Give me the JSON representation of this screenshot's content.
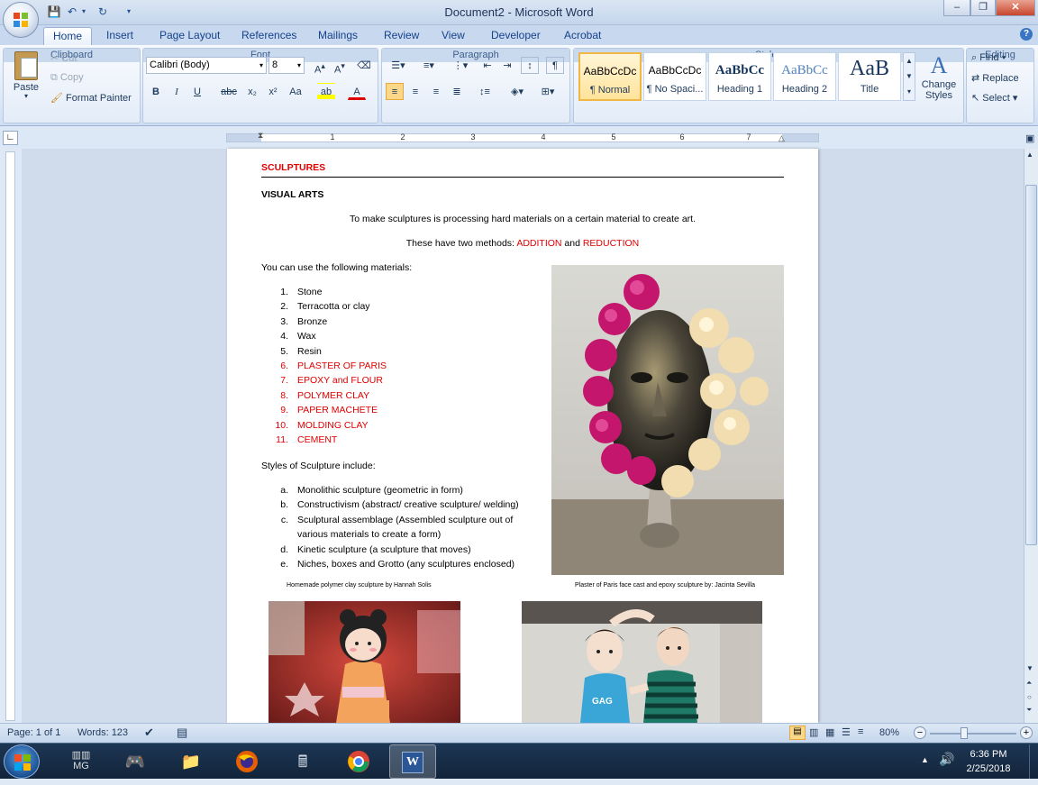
{
  "window": {
    "title": "Document2 - Microsoft Word",
    "minimize": "–",
    "restore": "❐",
    "close": "✕"
  },
  "tabs": [
    {
      "label": "Home"
    },
    {
      "label": "Insert"
    },
    {
      "label": "Page Layout"
    },
    {
      "label": "References"
    },
    {
      "label": "Mailings"
    },
    {
      "label": "Review"
    },
    {
      "label": "View"
    },
    {
      "label": "Developer"
    },
    {
      "label": "Acrobat"
    }
  ],
  "ribbon": {
    "clipboard": {
      "label": "Clipboard",
      "paste": "Paste",
      "cut": "Cut",
      "copy": "Copy",
      "format_painter": "Format Painter"
    },
    "font": {
      "label": "Font",
      "family": "Calibri (Body)",
      "size": "8"
    },
    "paragraph": {
      "label": "Paragraph"
    },
    "styles": {
      "label": "Styles",
      "items": [
        {
          "sample": "AaBbCcDc",
          "name": "¶ Normal"
        },
        {
          "sample": "AaBbCcDc",
          "name": "¶ No Spaci..."
        },
        {
          "sample": "AaBbCc",
          "name": "Heading 1"
        },
        {
          "sample": "AaBbCc",
          "name": "Heading 2"
        },
        {
          "sample": "AaB",
          "name": "Title"
        }
      ],
      "change_styles": "Change Styles"
    },
    "editing": {
      "label": "Editing",
      "find": "Find",
      "replace": "Replace",
      "select": "Select"
    }
  },
  "ruler": {
    "numbers": [
      "1",
      "2",
      "3",
      "4",
      "5",
      "6",
      "7"
    ]
  },
  "document": {
    "heading": "SCULPTURES",
    "subheading": "VISUAL ARTS",
    "intro": "To make sculptures is processing hard materials on a certain material to create art.",
    "methods_prefix": "These have two methods: ",
    "method_1": "ADDITION",
    "methods_and": " and ",
    "method_2": "REDUCTION",
    "materials_intro": "You can use the following materials:",
    "materials": [
      {
        "num": "1.",
        "text": "Stone",
        "red": false
      },
      {
        "num": "2.",
        "text": "Terracotta or clay",
        "red": false
      },
      {
        "num": "3.",
        "text": "Bronze",
        "red": false
      },
      {
        "num": "4.",
        "text": "Wax",
        "red": false
      },
      {
        "num": "5.",
        "text": "Resin",
        "red": false
      },
      {
        "num": "6.",
        "text": "PLASTER OF PARIS",
        "red": true
      },
      {
        "num": "7.",
        "text": "EPOXY and FLOUR",
        "red": true
      },
      {
        "num": "8.",
        "text": "POLYMER CLAY",
        "red": true
      },
      {
        "num": "9.",
        "text": "PAPER MACHETE",
        "red": true
      },
      {
        "num": "10.",
        "text": "MOLDING CLAY",
        "red": true
      },
      {
        "num": "11.",
        "text": "CEMENT",
        "red": true
      }
    ],
    "styles_intro": "Styles of Sculpture include:",
    "styles": [
      {
        "letter": "a.",
        "text": "Monolithic sculpture (geometric in form)"
      },
      {
        "letter": "b.",
        "text": "Constructivism (abstract/ creative sculpture/ welding)"
      },
      {
        "letter": "c.",
        "text": "Sculptural assemblage (Assembled sculpture out of"
      },
      {
        "letter": "",
        "text": "various materials to create a form)"
      },
      {
        "letter": "d.",
        "text": "Kinetic sculpture (a sculpture that moves)"
      },
      {
        "letter": "e.",
        "text": "Niches, boxes and Grotto (any sculptures enclosed)"
      }
    ],
    "caption_left": "Homemade polymer clay sculpture by Hannah Solis",
    "caption_right": "Plaster of Paris face cast and epoxy sculpture by: Jacinta Sevilla"
  },
  "statusbar": {
    "page": "Page: 1 of 1",
    "words": "Words: 123",
    "zoom": "80%"
  },
  "taskbar": {
    "time": "6:36 PM",
    "date": "2/25/2018"
  },
  "colors": {
    "accent_red": "#e00000",
    "ribbon_blue": "#15428b"
  }
}
